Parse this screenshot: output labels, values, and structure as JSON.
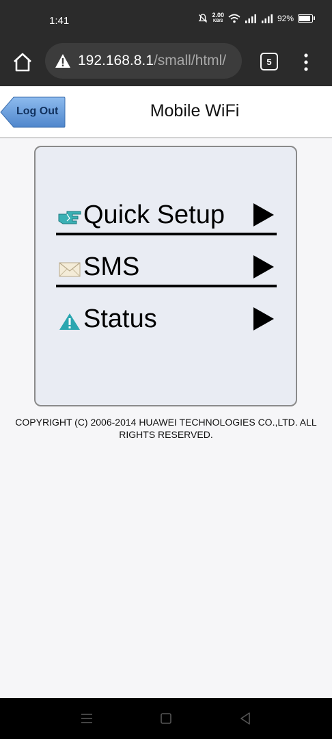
{
  "status_bar": {
    "time": "1:41",
    "net_speed": "2.00",
    "net_speed_unit": "KB/S",
    "battery": "92%"
  },
  "browser": {
    "url_host": "192.168.8.1",
    "url_path": "/small/html/",
    "tab_count": "5"
  },
  "header": {
    "logout_label": "Log Out",
    "title": "Mobile WiFi"
  },
  "menu": {
    "items": [
      {
        "label": "Quick Setup",
        "icon": "pointing-hand-icon"
      },
      {
        "label": "SMS",
        "icon": "envelope-icon"
      },
      {
        "label": "Status",
        "icon": "warning-icon"
      }
    ]
  },
  "footer": {
    "copyright": "COPYRIGHT (C) 2006-2014 HUAWEI TECHNOLOGIES CO.,LTD. ALL RIGHTS RESERVED."
  },
  "colors": {
    "logout_button": "#5f96d6",
    "panel_bg": "#e9ecf3",
    "status_icon": "#2aa6b0"
  }
}
